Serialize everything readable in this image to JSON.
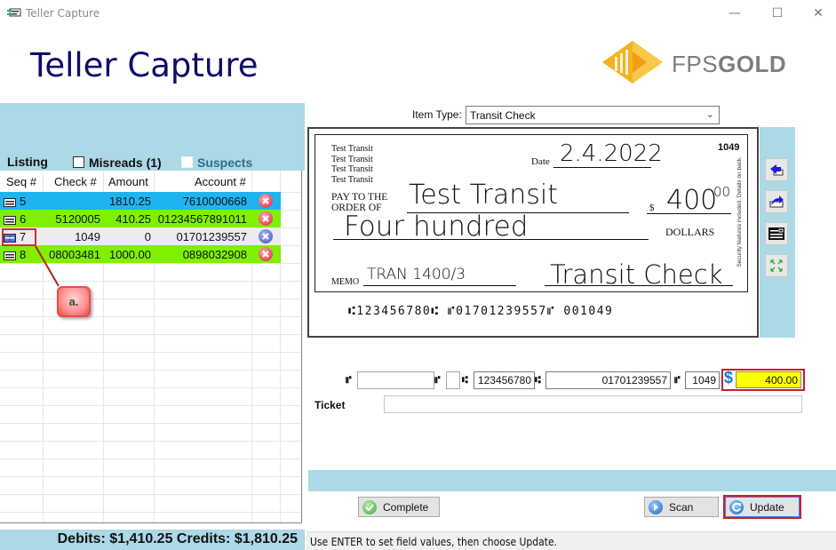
{
  "window": {
    "title": "Teller Capture",
    "minimize_glyph": "—",
    "maximize_glyph": "☐",
    "close_glyph": "✕"
  },
  "header": {
    "title": "Teller Capture",
    "logo_text_light": "FPS",
    "logo_text_bold": "GOLD"
  },
  "listing": {
    "label": "Listing",
    "misreads_label": "Misreads (1)",
    "misreads_checked": false,
    "suspects_label": "Suspects",
    "suspects_checked": false,
    "columns": [
      "Seq #",
      "Check #",
      "Amount",
      "Account #"
    ],
    "rows": [
      {
        "seq": "5",
        "check": "",
        "amount": "1810.25",
        "account": "7610000668",
        "row_color": "#1eb4f0",
        "icon": "deposit-ticket-icon",
        "delete_icon": "delete-red-icon"
      },
      {
        "seq": "6",
        "check": "5120005",
        "amount": "410.25",
        "account": "01234567891011",
        "row_color": "#80f000",
        "icon": "deposit-ticket-icon",
        "delete_icon": "delete-red-icon"
      },
      {
        "seq": "7",
        "check": "1049",
        "amount": "0",
        "account": "01701239557",
        "row_color": "#ececec",
        "icon": "check-misread-icon",
        "delete_icon": "delete-blue-icon"
      },
      {
        "seq": "8",
        "check": "08003481",
        "amount": "1000.00",
        "account": "0898032908",
        "row_color": "#80f000",
        "icon": "deposit-ticket-icon",
        "delete_icon": "delete-red-icon"
      }
    ],
    "callout_label": "a."
  },
  "totals": {
    "text": "Debits: $1,410.25 Credits: $1,810.25",
    "debits": "$1,410.25",
    "credits": "$1,810.25"
  },
  "item_type": {
    "label": "Item Type:",
    "value": "Transit Check"
  },
  "check_image": {
    "address_lines": [
      "Test Transit",
      "Test Transit",
      "Test Transit",
      "Test Transit"
    ],
    "check_number": "1049",
    "date_label": "Date",
    "date_value": "2.4.2022",
    "pay_to_label_1": "PAY TO THE",
    "pay_to_label_2": "ORDER OF",
    "payee": "Test Transit",
    "dollar_sign": "$",
    "amount": "400",
    "amount_cents": "00",
    "written_amount": "Four hundred",
    "dollars_label": "DOLLARS",
    "memo_label": "MEMO",
    "memo_value": "TRAN 1400/3",
    "signature": "Transit Check",
    "security_text": "Security features included. Details on back.",
    "micr_line": "⑆123456780⑆ ⑈01701239557⑈ 001049"
  },
  "image_tools": [
    {
      "name": "rotate-front-icon"
    },
    {
      "name": "flip-back-icon"
    },
    {
      "name": "view-micr-icon"
    },
    {
      "name": "zoom-expand-icon"
    }
  ],
  "micr_fields": {
    "aux_on_us": "",
    "epc": "",
    "routing": "123456780",
    "account": "01701239557",
    "serial": "1049",
    "amount": "400.00",
    "on_us_symbol": "⑈",
    "transit_symbol": "⑆"
  },
  "ticket": {
    "label": "Ticket",
    "value": ""
  },
  "buttons": {
    "complete": "Complete",
    "scan": "Scan",
    "update": "Update"
  },
  "status": {
    "text": "Use ENTER to set field values, then choose Update."
  },
  "colors": {
    "band": "#add8e6",
    "title_navy": "#0d0d6b",
    "highlight_red": "#c8202a",
    "amount_yellow": "#ffff00"
  }
}
